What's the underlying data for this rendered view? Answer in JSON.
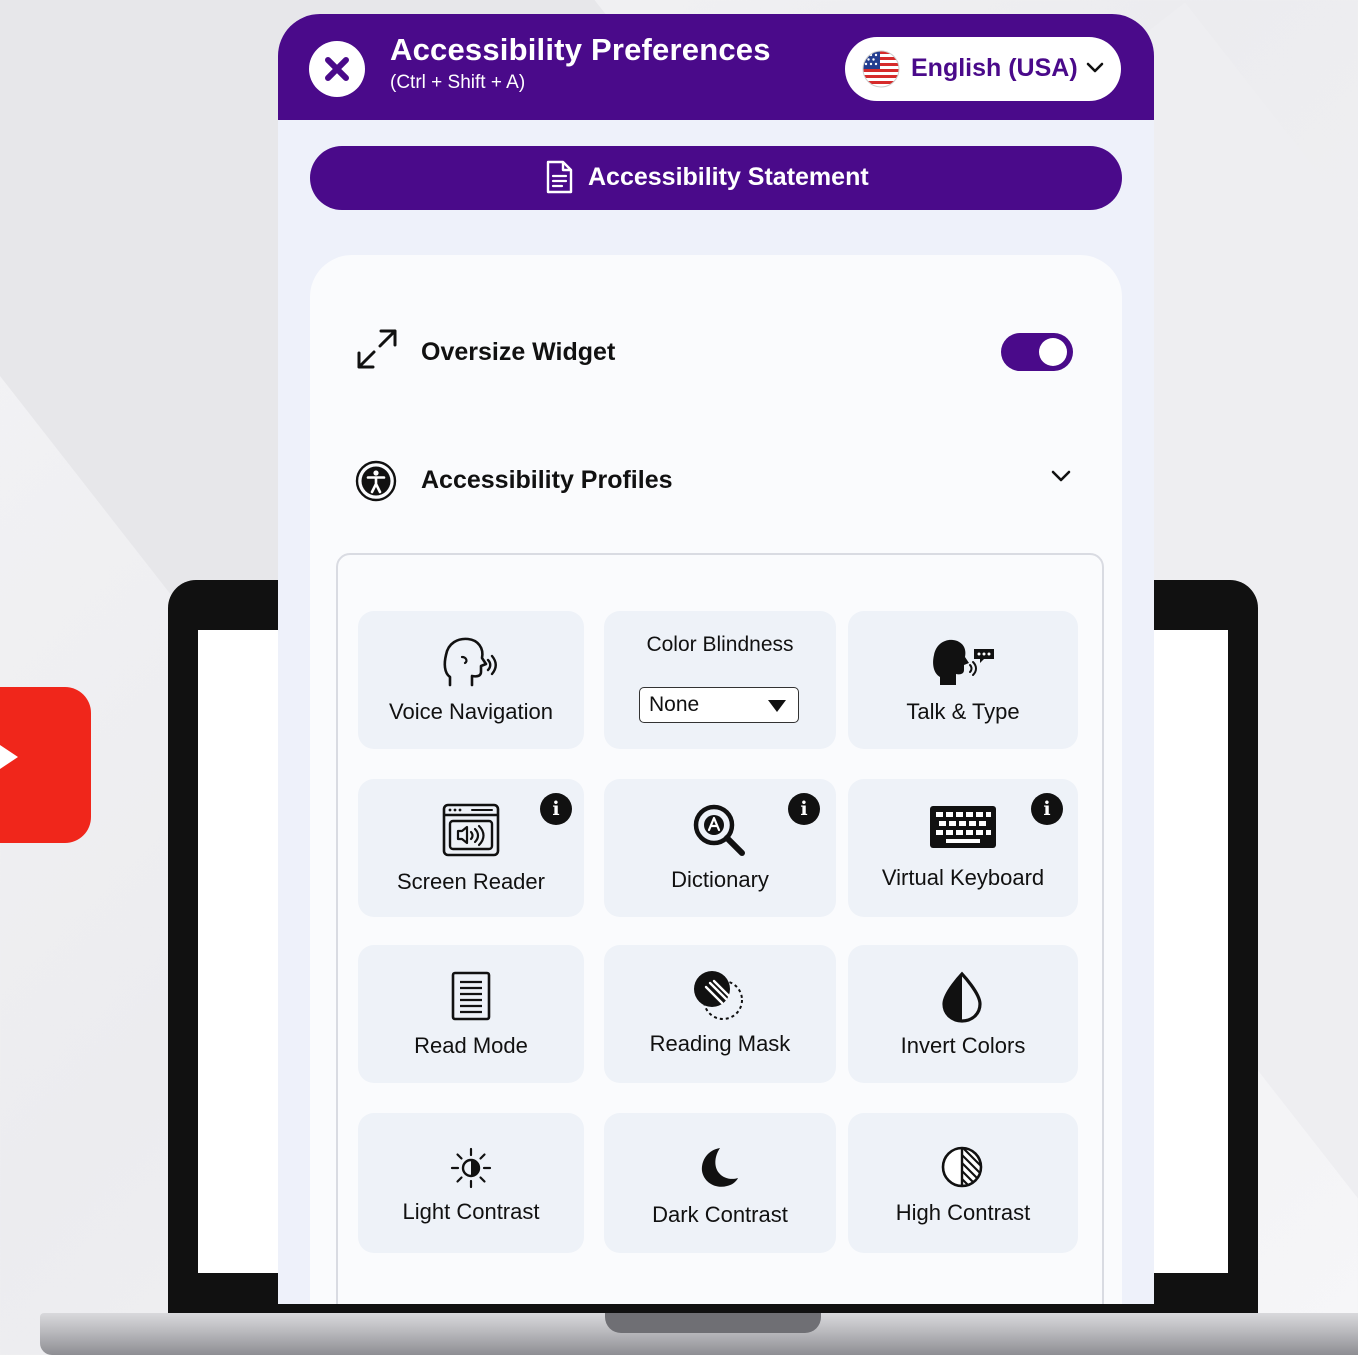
{
  "panel": {
    "title": "Accessibility Preferences",
    "shortcut": "(Ctrl + Shift + A)",
    "language": "English (USA)",
    "statement_label": "Accessibility Statement",
    "colors": {
      "primary": "#4a0a8a",
      "background": "#eef1fa",
      "tile": "#eef2f8"
    }
  },
  "settings": {
    "oversize_label": "Oversize Widget",
    "oversize_enabled": true,
    "profiles_label": "Accessibility Profiles"
  },
  "tools": {
    "voice_navigation": "Voice Navigation",
    "color_blindness_title": "Color Blindness",
    "color_blindness_value": "None",
    "talk_type": "Talk & Type",
    "screen_reader": "Screen Reader",
    "dictionary": "Dictionary",
    "virtual_keyboard": "Virtual Keyboard",
    "read_mode": "Read Mode",
    "reading_mask": "Reading Mask",
    "invert_colors": "Invert Colors",
    "light_contrast": "Light Contrast",
    "dark_contrast": "Dark Contrast",
    "high_contrast": "High Contrast",
    "info_glyph": "i"
  },
  "icons": {
    "close": "close-icon",
    "flag": "us-flag-icon",
    "statement": "document-icon",
    "oversize": "expand-icon",
    "profiles": "accessibility-person-icon",
    "youtube": "play-icon"
  }
}
